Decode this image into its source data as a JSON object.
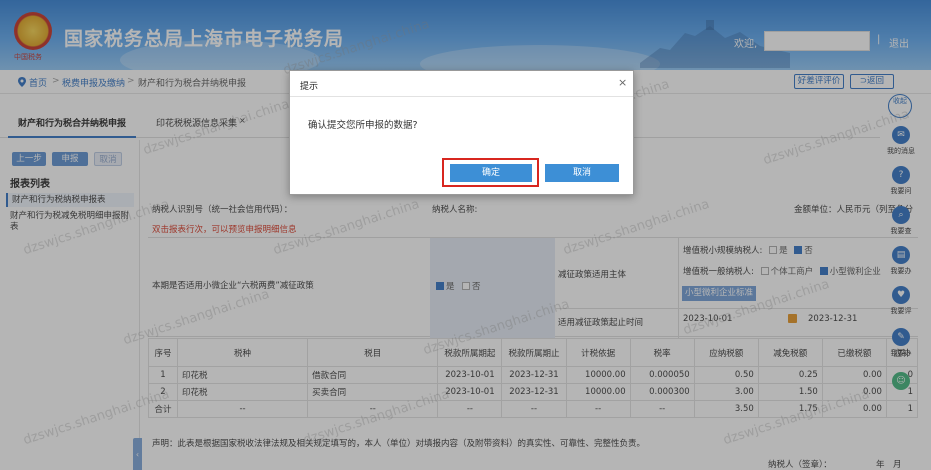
{
  "header": {
    "site_title": "国家税务总局上海市电子税务局",
    "emblem_text": "中国税务",
    "welcome": "欢迎,",
    "separator": "|",
    "logout": "退出"
  },
  "breadcrumb": {
    "home": "首页",
    "sep": ">",
    "level1": "税费申报及缴纳",
    "current": "财产和行为税合并纳税申报",
    "rate_button": "好差评评价",
    "back_button": "返回"
  },
  "tabs": [
    {
      "label": "财产和行为税合并纳税申报"
    },
    {
      "label": "印花税税源信息采集",
      "close": "×"
    }
  ],
  "left": {
    "prev": "上一步",
    "submit": "申报",
    "cancel": "取消",
    "list_title": "报表列表",
    "items": [
      "财产和行为税纳税申报表",
      "财产和行为税减免税明细申报附表"
    ],
    "collapse": "‹"
  },
  "form": {
    "taxpayer_id_label": "纳税人识别号（统一社会信用代码）：",
    "taxpayer_name_label": "纳税人名称:",
    "unit_label": "金额单位：人民币元（列至角分",
    "hint": "双击报表行次，可以预览申报明细信息",
    "policy_label": "本期是否适用小微企业“六税两费”减征政策",
    "yes": "是",
    "no": "否",
    "subject_label": "减征政策适用主体",
    "vat_small_label": "增值税小规模纳税人:",
    "vat_general_label": "增值税一般纳税人:",
    "individual": "个体工商户",
    "micro": "小型微利企业",
    "std_button": "小型微利企业标准",
    "start_date_label": "适用减征政策起止时间",
    "start_date": "2023-10-01",
    "end_date": "2023-12-31",
    "declaration": "声明：此表是根据国家税收法律法规及相关规定填写的，本人（单位）对填报内容（及附带资料）的真实性、可靠性、完整性负责。",
    "signer": "纳税人（签章）：",
    "sign_date": "年　月"
  },
  "table": {
    "headers": [
      "序号",
      "税种",
      "税目",
      "税款所属期起",
      "税款所属期止",
      "计税依据",
      "税率",
      "应纳税额",
      "减免税额",
      "已缴税额",
      "应补"
    ],
    "rows": [
      [
        "1",
        "印花税",
        "借款合同",
        "2023-10-01",
        "2023-12-31",
        "10000.00",
        "0.000050",
        "0.50",
        "0.25",
        "0.00",
        "0"
      ],
      [
        "2",
        "印花税",
        "买卖合同",
        "2023-10-01",
        "2023-12-31",
        "10000.00",
        "0.000300",
        "3.00",
        "1.50",
        "0.00",
        "1"
      ],
      [
        "合计",
        "--",
        "--",
        "--",
        "--",
        "--",
        "--",
        "3.50",
        "1.75",
        "0.00",
        "1"
      ]
    ]
  },
  "rightbar": {
    "collapse": "收起",
    "items": [
      "我的消息",
      "我要问",
      "我要查",
      "我要办",
      "我要评",
      "我要办"
    ]
  },
  "dialog": {
    "title": "提示",
    "close": "×",
    "message": "确认提交您所申报的数据?",
    "ok": "确定",
    "cancel": "取消"
  },
  "watermark": "dzswjcs.shanghai.china",
  "colors": {
    "accent": "#2a6fc2",
    "highlight": "#d8261f",
    "dialog_button": "#3d8fd6"
  }
}
